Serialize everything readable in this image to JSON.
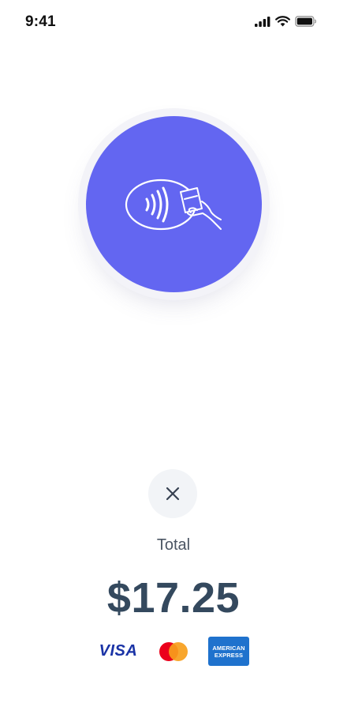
{
  "status_bar": {
    "time": "9:41"
  },
  "payment": {
    "total_label": "Total",
    "amount": "$17.25"
  },
  "card_brands": {
    "visa": "VISA",
    "amex_line1": "AMERICAN",
    "amex_line2": "EXPRESS"
  },
  "colors": {
    "accent": "#6366f1",
    "amount_text": "#34495e",
    "cancel_bg": "#f2f4f7"
  },
  "icons": [
    "contactless-tap-icon",
    "close-icon",
    "mastercard-logo",
    "cellular-signal-icon",
    "wifi-icon",
    "battery-icon"
  ]
}
